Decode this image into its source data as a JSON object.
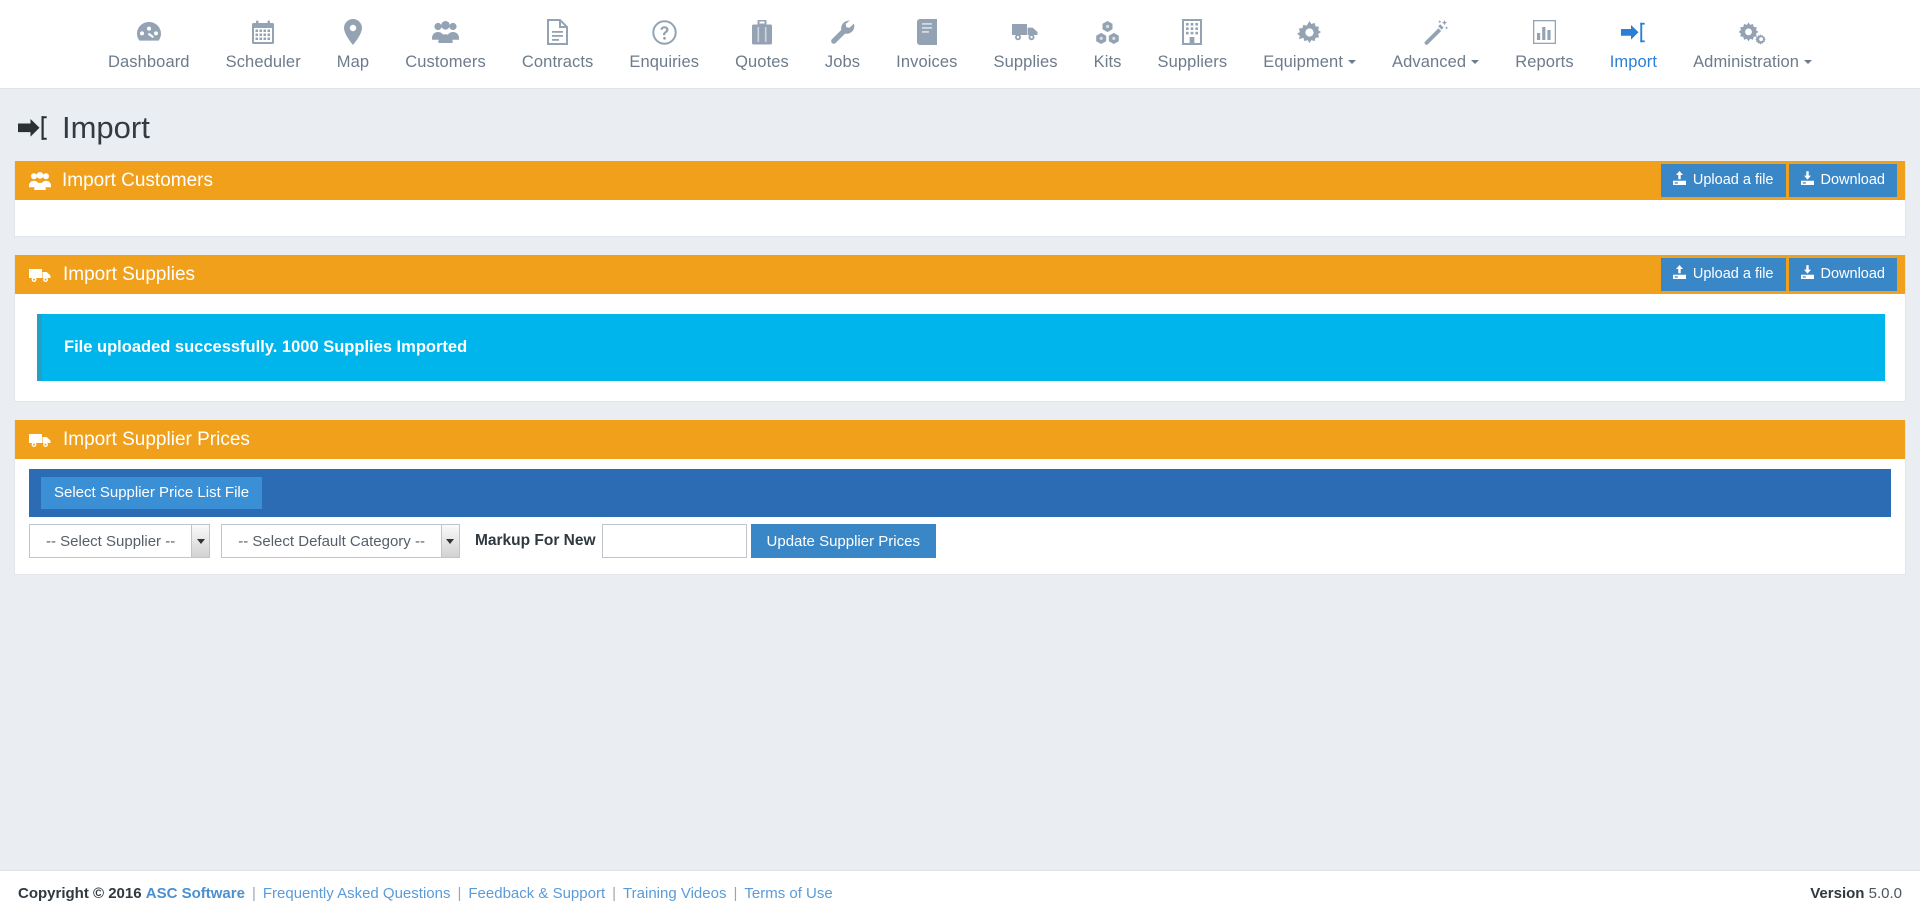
{
  "nav": {
    "items": [
      {
        "label": "Dashboard",
        "icon": "dashboard-gauge-icon",
        "active": false,
        "caret": false
      },
      {
        "label": "Scheduler",
        "icon": "calendar-icon",
        "active": false,
        "caret": false
      },
      {
        "label": "Map",
        "icon": "map-pin-icon",
        "active": false,
        "caret": false
      },
      {
        "label": "Customers",
        "icon": "users-group-icon",
        "active": false,
        "caret": false
      },
      {
        "label": "Contracts",
        "icon": "document-icon",
        "active": false,
        "caret": false
      },
      {
        "label": "Enquiries",
        "icon": "question-circle-icon",
        "active": false,
        "caret": false
      },
      {
        "label": "Quotes",
        "icon": "briefcase-icon",
        "active": false,
        "caret": false
      },
      {
        "label": "Jobs",
        "icon": "wrench-icon",
        "active": false,
        "caret": false
      },
      {
        "label": "Invoices",
        "icon": "book-icon",
        "active": false,
        "caret": false
      },
      {
        "label": "Supplies",
        "icon": "truck-icon",
        "active": false,
        "caret": false
      },
      {
        "label": "Kits",
        "icon": "cubes-icon",
        "active": false,
        "caret": false
      },
      {
        "label": "Suppliers",
        "icon": "building-icon",
        "active": false,
        "caret": false
      },
      {
        "label": "Equipment",
        "icon": "gear-icon",
        "active": false,
        "caret": true
      },
      {
        "label": "Advanced",
        "icon": "magic-wand-icon",
        "active": false,
        "caret": true
      },
      {
        "label": "Reports",
        "icon": "bar-chart-icon",
        "active": false,
        "caret": false
      },
      {
        "label": "Import",
        "icon": "sign-in-arrow-icon",
        "active": true,
        "caret": false
      },
      {
        "label": "Administration",
        "icon": "gears-icon",
        "active": false,
        "caret": true
      }
    ]
  },
  "page": {
    "title": "Import",
    "title_icon": "sign-in-arrow-icon"
  },
  "panels": [
    {
      "key": "customers",
      "title": "Import Customers",
      "icon": "users-group-icon",
      "upload_label": "Upload a file",
      "download_label": "Download",
      "upload_icon": "upload-icon",
      "download_icon": "download-icon"
    },
    {
      "key": "supplies",
      "title": "Import Supplies",
      "icon": "truck-icon",
      "upload_label": "Upload a file",
      "download_label": "Download",
      "upload_icon": "upload-icon",
      "download_icon": "download-icon",
      "alert": "File uploaded successfully. 1000 Supplies Imported"
    },
    {
      "key": "supplier_prices",
      "title": "Import Supplier Prices",
      "icon": "truck-icon",
      "select_file_label": "Select Supplier Price List File",
      "supplier_select": "-- Select Supplier --",
      "category_select": "-- Select Default Category --",
      "markup_label": "Markup For New",
      "markup_value": "",
      "markup_placeholder": "",
      "update_label": "Update Supplier Prices"
    }
  ],
  "footer": {
    "copyright": "Copyright © 2016",
    "brand": "ASC Software",
    "links": [
      "Frequently Asked Questions",
      "Feedback & Support",
      "Training Videos",
      "Terms of Use"
    ],
    "version_label": "Version",
    "version_value": "5.0.0"
  },
  "colors": {
    "panel_heading": "#f0a01a",
    "accent_blue": "#3a87c8",
    "alert_cyan": "#00b5ec",
    "filebar_blue": "#2b6cb5",
    "active_nav": "#2b7fd4",
    "page_bg": "#eaedf1"
  }
}
